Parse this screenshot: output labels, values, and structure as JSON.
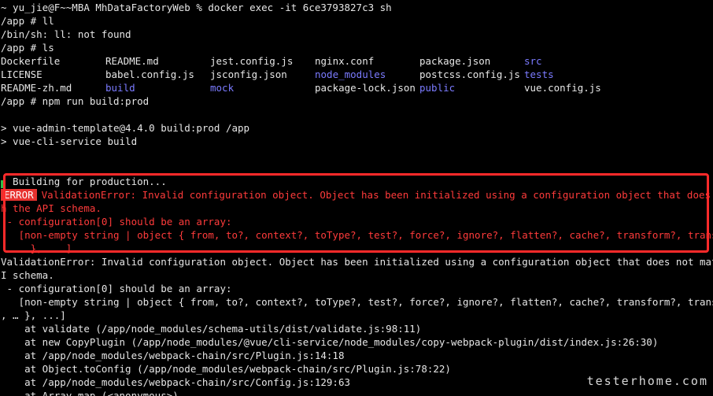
{
  "terminal": {
    "prompt_line": "~ yu_jie@F~~MBA MhDataFactoryWeb % docker exec -it 6ce3793827c3 sh",
    "cmd_ll": "/app # ll",
    "ll_error": "/bin/sh: ll: not found",
    "cmd_ls": "/app # ls",
    "ls_rows": [
      [
        {
          "name": "Dockerfile",
          "dir": false
        },
        {
          "name": "README.md",
          "dir": false
        },
        {
          "name": "jest.config.js",
          "dir": false
        },
        {
          "name": "nginx.conf",
          "dir": false
        },
        {
          "name": "package.json",
          "dir": false
        },
        {
          "name": "src",
          "dir": true
        }
      ],
      [
        {
          "name": "LICENSE",
          "dir": false
        },
        {
          "name": "babel.config.js",
          "dir": false
        },
        {
          "name": "jsconfig.json",
          "dir": false
        },
        {
          "name": "node_modules",
          "dir": true
        },
        {
          "name": "postcss.config.js",
          "dir": false
        },
        {
          "name": "tests",
          "dir": true
        }
      ],
      [
        {
          "name": "README-zh.md",
          "dir": false
        },
        {
          "name": "build",
          "dir": true
        },
        {
          "name": "mock",
          "dir": true
        },
        {
          "name": "package-lock.json",
          "dir": false
        },
        {
          "name": "public",
          "dir": true
        },
        {
          "name": "vue.config.js",
          "dir": false
        }
      ]
    ],
    "cmd_build": "/app # npm run build:prod",
    "npm_script_line": "> vue-admin-template@4.4.0 build:prod /app",
    "npm_cmd_line": "> vue-cli-service build",
    "building_line": "  Building for production...",
    "error_badge": "ERROR",
    "error_line1": "ValidationError: Invalid configuration object. Object has been initialized using a configuration object that does not mat",
    "error_line2": "h the API schema.",
    "error_line3": " - configuration[0] should be an array:",
    "error_line4": "   [non-empty string | object { from, to?, context?, toType?, test?, force?, ignore?, flatten?, cache?, transform?, transformPath",
    "error_line5": "   … }, ...]",
    "plain_line1": "ValidationError: Invalid configuration object. Object has been initialized using a configuration object that does not match the A",
    "plain_line2": "I schema.",
    "plain_line3": " - configuration[0] should be an array:",
    "plain_line4": "   [non-empty string | object { from, to?, context?, toType?, test?, force?, ignore?, flatten?, cache?, transform?, transformPath?",
    "plain_line5": ", … }, ...]",
    "stack": [
      "    at validate (/app/node_modules/schema-utils/dist/validate.js:98:11)",
      "    at new CopyPlugin (/app/node_modules/@vue/cli-service/node_modules/copy-webpack-plugin/dist/index.js:26:30)",
      "    at /app/node_modules/webpack-chain/src/Plugin.js:14:18",
      "    at Object.toConfig (/app/node_modules/webpack-chain/src/Plugin.js:78:22)",
      "    at /app/node_modules/webpack-chain/src/Config.js:129:63",
      "    at Array.map (<anonymous>)"
    ],
    "watermark": "testerhome.com"
  },
  "colors": {
    "background": "#000000",
    "text": "#e6e6e6",
    "directory": "#7b7bff",
    "error_text": "#ff3b3b",
    "error_badge_bg": "#e8322f",
    "highlight_border": "#ff2a2a"
  }
}
